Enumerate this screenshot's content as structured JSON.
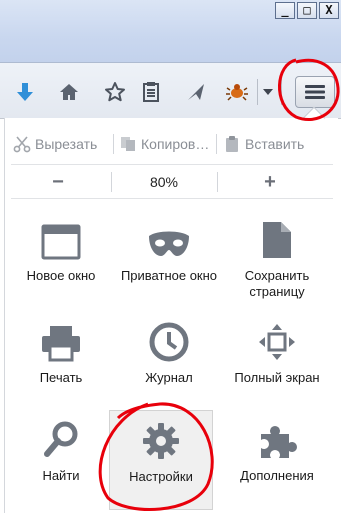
{
  "window_controls": {
    "minimize": "_",
    "restore": "□",
    "close": "X"
  },
  "toolbar": {
    "icons": [
      "download-icon",
      "home-icon",
      "bookmark-star-icon",
      "reading-list-icon",
      "send-icon",
      "addon-bug-icon",
      "dropdown-icon",
      "hamburger-menu-icon"
    ]
  },
  "edit": {
    "cut_label": "Вырезать",
    "copy_label": "Копиров…",
    "paste_label": "Вставить"
  },
  "zoom": {
    "minus_label": "−",
    "value": "80%",
    "plus_label": "+"
  },
  "tiles": [
    {
      "label": "Новое окно",
      "icon": "new-window-icon"
    },
    {
      "label": "Приватное окно",
      "icon": "private-mask-icon"
    },
    {
      "label": "Сохранить страницу",
      "icon": "save-page-icon"
    },
    {
      "label": "Печать",
      "icon": "print-icon"
    },
    {
      "label": "Журнал",
      "icon": "history-clock-icon"
    },
    {
      "label": "Полный экран",
      "icon": "fullscreen-icon"
    },
    {
      "label": "Найти",
      "icon": "search-icon"
    },
    {
      "label": "Настройки",
      "icon": "settings-gear-icon"
    },
    {
      "label": "Дополнения",
      "icon": "addons-puzzle-icon"
    }
  ],
  "colors": {
    "annotation": "#e8000b",
    "icon_gray": "#6f7680",
    "download_blue": "#2f8fd8"
  }
}
